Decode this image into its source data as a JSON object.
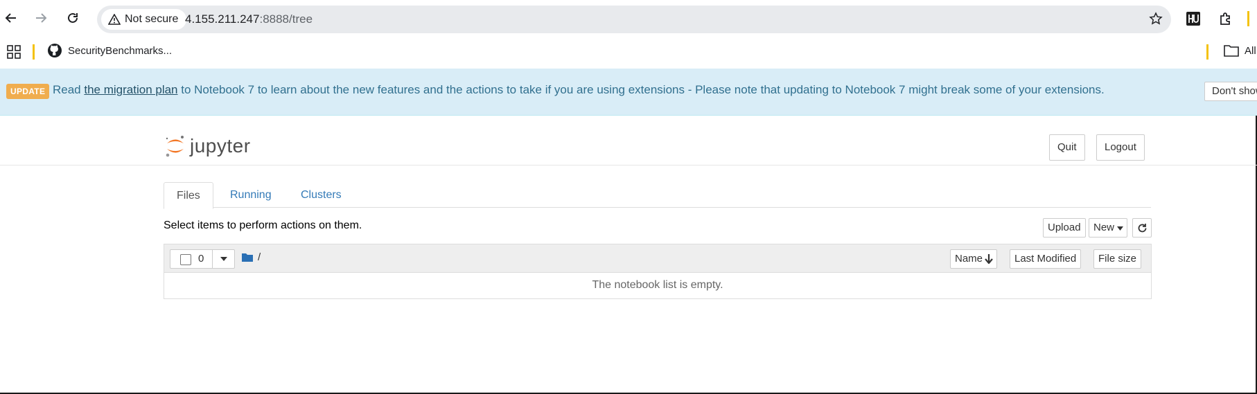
{
  "browser": {
    "security_chip": "Not secure",
    "url_host": "4.155.211.247",
    "url_rest": ":8888/tree"
  },
  "bookmarks": {
    "items": [
      {
        "label": "SecurityBenchmarks...",
        "icon": "github-icon"
      }
    ],
    "all_label": "All"
  },
  "banner": {
    "badge": "UPDATE",
    "text_before": "Read ",
    "link": "the migration plan",
    "text_after": " to Notebook 7 to learn about the new features and the actions to take if you are using extensions - Please note that updating to Notebook 7 might break some of your extensions.",
    "dismiss_label": "Don't show"
  },
  "header": {
    "logo_text": "jupyter",
    "quit_label": "Quit",
    "logout_label": "Logout"
  },
  "tabs": [
    {
      "label": "Files",
      "active": true
    },
    {
      "label": "Running",
      "active": false
    },
    {
      "label": "Clusters",
      "active": false
    }
  ],
  "toolbar": {
    "select_text": "Select items to perform actions on them.",
    "upload_label": "Upload",
    "new_label": "New"
  },
  "list": {
    "selected_count": "0",
    "breadcrumb": "/",
    "columns": [
      "Name",
      "Last Modified",
      "File size"
    ],
    "empty_message": "The notebook list is empty."
  },
  "colors": {
    "banner_bg": "#d9edf7",
    "badge_bg": "#f0ad4e",
    "link": "#337ab7",
    "jupyter_orange": "#f37726"
  }
}
